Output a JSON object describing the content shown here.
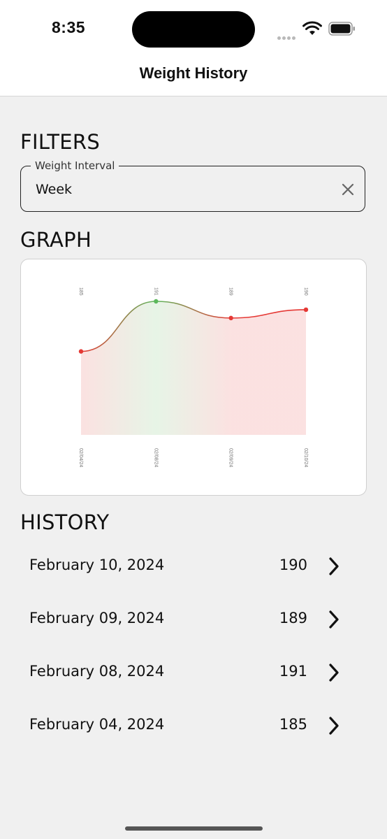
{
  "status_bar": {
    "time": "8:35"
  },
  "nav": {
    "title": "Weight History"
  },
  "filters": {
    "section_title": "FILTERS",
    "interval_label": "Weight Interval",
    "interval_value": "Week"
  },
  "graph": {
    "section_title": "GRAPH"
  },
  "chart_data": {
    "type": "area",
    "categories": [
      "02/04/24",
      "02/08/24",
      "02/09/24",
      "02/10/24"
    ],
    "values": [
      185,
      191,
      189,
      190
    ],
    "value_labels": [
      "185",
      "191",
      "189",
      "190"
    ],
    "point_colors": [
      "#e53935",
      "#5cb85c",
      "#e53935",
      "#e53935"
    ],
    "ylim": [
      175,
      191
    ],
    "grid": false,
    "legend": "none"
  },
  "history": {
    "section_title": "HISTORY",
    "entries": [
      {
        "date": "February 10, 2024",
        "weight": "190"
      },
      {
        "date": "February 09, 2024",
        "weight": "189"
      },
      {
        "date": "February 08, 2024",
        "weight": "191"
      },
      {
        "date": "February 04, 2024",
        "weight": "185"
      }
    ]
  }
}
